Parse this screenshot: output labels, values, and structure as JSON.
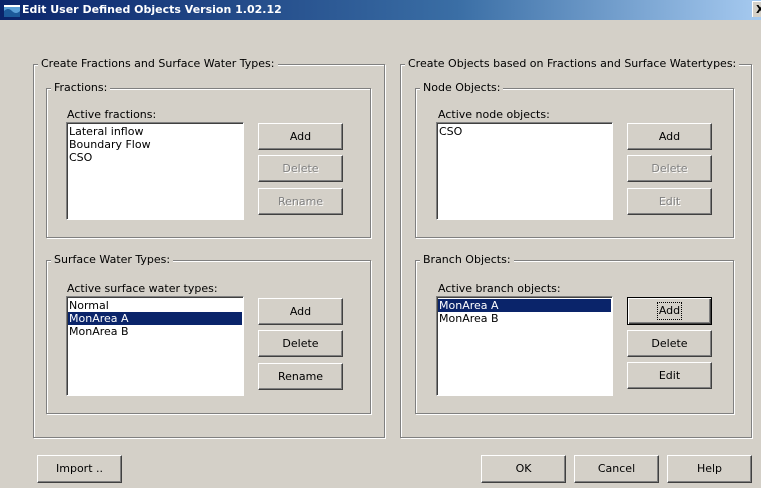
{
  "window": {
    "title": "Edit User Defined Objects Version 1.02.12",
    "close_label": "X"
  },
  "left_panel": {
    "title": "Create Fractions and Surface Water Types:",
    "fractions": {
      "title": "Fractions:",
      "list_label": "Active fractions:",
      "items": [
        "Lateral inflow",
        "Boundary Flow",
        "CSO"
      ],
      "buttons": {
        "add": "Add",
        "delete": "Delete",
        "rename": "Rename"
      }
    },
    "surface_water": {
      "title": "Surface Water Types:",
      "list_label": "Active surface water types:",
      "items": [
        "Normal",
        "MonArea A",
        "MonArea B"
      ],
      "selected": "MonArea A",
      "buttons": {
        "add": "Add",
        "delete": "Delete",
        "rename": "Rename"
      }
    }
  },
  "right_panel": {
    "title": "Create Objects based on Fractions and Surface Watertypes:",
    "node_objects": {
      "title": "Node Objects:",
      "list_label": "Active node objects:",
      "items": [
        "CSO"
      ],
      "buttons": {
        "add": "Add",
        "delete": "Delete",
        "edit": "Edit"
      }
    },
    "branch_objects": {
      "title": "Branch Objects:",
      "list_label": "Active branch objects:",
      "items": [
        "MonArea A",
        "MonArea B"
      ],
      "selected": "MonArea A",
      "buttons": {
        "add": "Add",
        "delete": "Delete",
        "edit": "Edit"
      }
    }
  },
  "footer": {
    "import": "Import ..",
    "ok": "OK",
    "cancel": "Cancel",
    "help": "Help"
  }
}
